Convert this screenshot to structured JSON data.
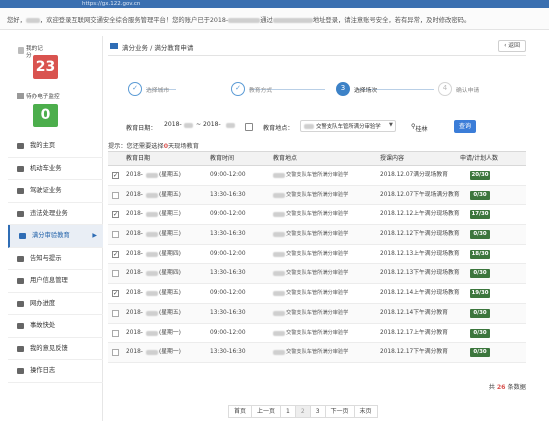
{
  "browser": {
    "url": "https://gx.122.gov.cn"
  },
  "notice": {
    "greeting": "您好，",
    "welcome": "，欢迎登录互联网交通安全综合服务管理平台！",
    "account_prefix": "您的账户已于2018-",
    "account_mid": "通过",
    "account_suffix": "地址登录，请注意账号安全，若有异常，及时修改密码。"
  },
  "sidebar": {
    "score_label": "我的记分",
    "score_value": "23",
    "pending_label": "待办电子监控",
    "pending_value": "0",
    "items": [
      {
        "label": "我的主页",
        "icon": "home-icon"
      },
      {
        "label": "机动车业务",
        "icon": "car-icon"
      },
      {
        "label": "驾驶证业务",
        "icon": "license-icon"
      },
      {
        "label": "违法处理业务",
        "icon": "camera-icon"
      },
      {
        "label": "满分审验教育",
        "icon": "education-icon"
      },
      {
        "label": "告知与提示",
        "icon": "bell-icon"
      },
      {
        "label": "用户信息管理",
        "icon": "user-icon"
      },
      {
        "label": "网办进度",
        "icon": "progress-icon"
      },
      {
        "label": "事故快处",
        "icon": "accident-icon"
      },
      {
        "label": "我的意见反馈",
        "icon": "feedback-icon"
      },
      {
        "label": "操作日志",
        "icon": "log-icon"
      }
    ],
    "active_index": 4
  },
  "breadcrumb": {
    "text": "满分业务 / 满分教育申请",
    "back": "返回"
  },
  "steps": [
    {
      "num": "✓",
      "label": "选择城市",
      "state": "done"
    },
    {
      "num": "✓",
      "label": "教育方式",
      "state": "done"
    },
    {
      "num": "3",
      "label": "选择场次",
      "state": "current"
    },
    {
      "num": "4",
      "label": "确认申请",
      "state": "todo"
    }
  ],
  "filters": {
    "date_label": "教育日期：",
    "date_from": "2018-",
    "date_sep": "~ 2018-",
    "place_label": "教育地点：",
    "place_value": "交警支队车管所满分审验学",
    "city": "桂林",
    "query_button": "查询"
  },
  "hint": {
    "prefix": "提示：您还需要选择",
    "count": "0",
    "suffix": "天现场教育"
  },
  "table": {
    "columns": [
      "教育日期",
      "教育时间",
      "教育地点",
      "授课内容",
      "申请/计划人数"
    ],
    "rows": [
      {
        "checked": true,
        "date": "2018-",
        "week": "(星期五)",
        "time": "09:00-12:00",
        "place": "交警支队车管所满分审验学",
        "content": "2018.12.07满分现场教育",
        "quota": "20/30"
      },
      {
        "checked": false,
        "date": "2018-",
        "week": "(星期五)",
        "time": "13:30-16:30",
        "place": "交警支队车管所满分审验学",
        "content": "2018.12.07下午现场满分教育",
        "quota": "0/30"
      },
      {
        "checked": true,
        "date": "2018-",
        "week": "(星期三)",
        "time": "09:00-12:00",
        "place": "交警支队车管所满分审验学",
        "content": "2018.12.12上午满分现场教育",
        "quota": "17/30"
      },
      {
        "checked": false,
        "date": "2018-",
        "week": "(星期三)",
        "time": "13:30-16:30",
        "place": "交警支队车管所满分审验学",
        "content": "2018.12.12下午满分现场教育",
        "quota": "0/30"
      },
      {
        "checked": true,
        "date": "2018-",
        "week": "(星期四)",
        "time": "09:00-12:00",
        "place": "交警支队车管所满分审验学",
        "content": "2018.12.13上午满分现场教育",
        "quota": "18/30"
      },
      {
        "checked": false,
        "date": "2018-",
        "week": "(星期四)",
        "time": "13:30-16:30",
        "place": "交警支队车管所满分审验学",
        "content": "2018.12.13下午满分现场教育",
        "quota": "0/30"
      },
      {
        "checked": true,
        "date": "2018-",
        "week": "(星期五)",
        "time": "09:00-12:00",
        "place": "交警支队车管所满分审验学",
        "content": "2018.12.14上午满分现场教育",
        "quota": "19/30"
      },
      {
        "checked": false,
        "date": "2018-",
        "week": "(星期五)",
        "time": "13:30-16:30",
        "place": "交警支队车管所满分审验学",
        "content": "2018.12.14下午满分教育",
        "quota": "0/30"
      },
      {
        "checked": false,
        "date": "2018-",
        "week": "(星期一)",
        "time": "09:00-12:00",
        "place": "交警支队车管所满分审验学",
        "content": "2018.12.17上午满分教育",
        "quota": "0/30"
      },
      {
        "checked": false,
        "date": "2018-",
        "week": "(星期一)",
        "time": "13:30-16:30",
        "place": "交警支队车管所满分审验学",
        "content": "2018.12.17下午满分教育",
        "quota": "0/30"
      }
    ]
  },
  "total": {
    "prefix": "共",
    "count": "26",
    "suffix": "条数据"
  },
  "pager": {
    "first": "首页",
    "prev": "上一页",
    "pages": [
      "1",
      "2",
      "3"
    ],
    "next": "下一页",
    "last": "末页"
  },
  "colors": {
    "accent": "#2f6db5",
    "score": "#d9534f",
    "pending": "#4cae4c",
    "quota_bg": "#3c763d"
  }
}
